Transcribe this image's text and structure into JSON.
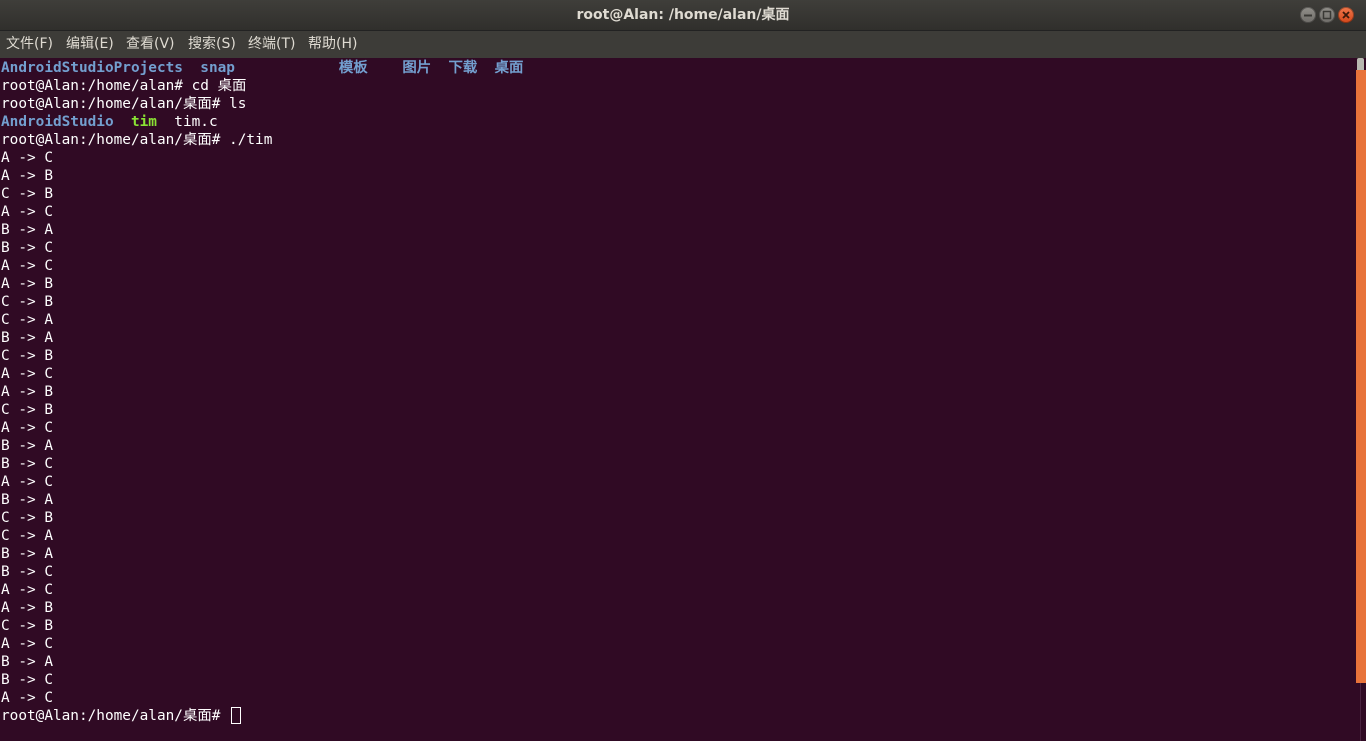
{
  "window": {
    "title": "root@Alan: /home/alan/桌面"
  },
  "menu": [
    "文件(F)",
    "编辑(E)",
    "查看(V)",
    "搜索(S)",
    "终端(T)",
    "帮助(H)"
  ],
  "terminal": {
    "ls_home_line": {
      "a": "AndroidStudioProjects",
      "b": "snap",
      "c": "模板",
      "d": "图片",
      "e": "下载",
      "f": "桌面"
    },
    "cmd1": "root@Alan:/home/alan# cd 桌面",
    "cmd2": "root@Alan:/home/alan/桌面# ls",
    "ls_desktop_line": {
      "a": "AndroidStudio",
      "b": "tim",
      "c": "tim.c"
    },
    "cmd3": "root@Alan:/home/alan/桌面# ./tim",
    "output": [
      "A -> C",
      "A -> B",
      "C -> B",
      "A -> C",
      "B -> A",
      "B -> C",
      "A -> C",
      "A -> B",
      "C -> B",
      "C -> A",
      "B -> A",
      "C -> B",
      "A -> C",
      "A -> B",
      "C -> B",
      "A -> C",
      "B -> A",
      "B -> C",
      "A -> C",
      "B -> A",
      "C -> B",
      "C -> A",
      "B -> A",
      "B -> C",
      "A -> C",
      "A -> B",
      "C -> B",
      "A -> C",
      "B -> A",
      "B -> C",
      "A -> C"
    ],
    "final_prompt": "root@Alan:/home/alan/桌面# "
  },
  "colors": {
    "background": "#300a24",
    "directory": "#739fcf",
    "executable": "#8ae234",
    "scroll_accent": "#e8733a"
  }
}
